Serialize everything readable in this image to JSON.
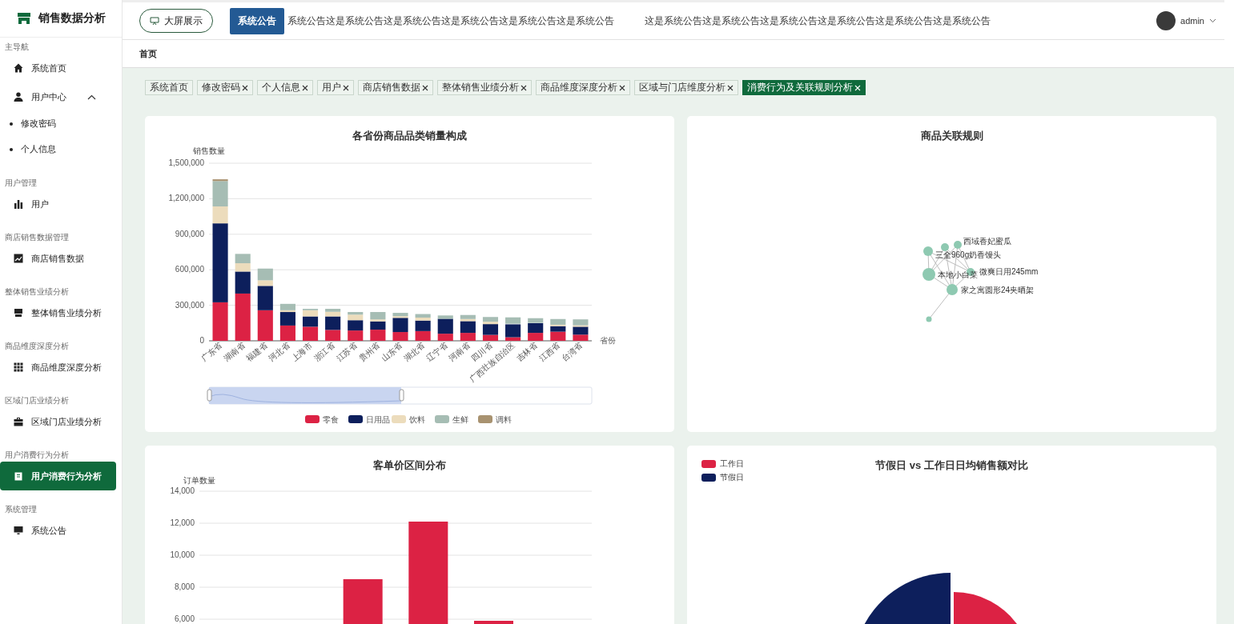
{
  "sidebar": {
    "title": "销售数据分析",
    "sections": [
      {
        "label": "主导航",
        "items": [
          {
            "label": "系统首页",
            "selected": false
          },
          {
            "label": "用户中心",
            "selected": false,
            "expanded": true,
            "children": [
              {
                "label": "修改密码",
                "selected": false
              },
              {
                "label": "个人信息",
                "selected": false
              }
            ]
          }
        ]
      },
      {
        "label": "用户管理",
        "items": [
          {
            "label": "用户",
            "selected": false
          }
        ]
      },
      {
        "label": "商店销售数据管理",
        "items": [
          {
            "label": "商店销售数据",
            "selected": false
          }
        ]
      },
      {
        "label": "整体销售业绩分析",
        "items": [
          {
            "label": "整体销售业绩分析",
            "selected": false
          }
        ]
      },
      {
        "label": "商品维度深度分析",
        "items": [
          {
            "label": "商品维度深度分析",
            "selected": false
          }
        ]
      },
      {
        "label": "区域门店业绩分析",
        "items": [
          {
            "label": "区域门店业绩分析",
            "selected": false
          }
        ]
      },
      {
        "label": "用户消费行为分析",
        "items": [
          {
            "label": "用户消费行为分析",
            "selected": true
          }
        ]
      },
      {
        "label": "系统管理",
        "items": [
          {
            "label": "系统公告",
            "selected": false
          }
        ]
      }
    ]
  },
  "header": {
    "big_screen_button": "大屏展示",
    "notice_label": "系统公告",
    "notices": [
      "系统公告这是系统公告这是系统公告这是系统公告这是系统公告这是系统公告",
      "这是系统公告这是系统公告这是系统公告这是系统公告这是系统公告这是系统公告"
    ],
    "user": "admin"
  },
  "breadcrumb": [
    "首页"
  ],
  "tabs": [
    {
      "label": "系统首页",
      "closable": false,
      "selected": false
    },
    {
      "label": "修改密码",
      "closable": true,
      "selected": false
    },
    {
      "label": "个人信息",
      "closable": true,
      "selected": false
    },
    {
      "label": "用户",
      "closable": true,
      "selected": false
    },
    {
      "label": "商店销售数据",
      "closable": true,
      "selected": false
    },
    {
      "label": "整体销售业绩分析",
      "closable": true,
      "selected": false
    },
    {
      "label": "商品维度深度分析",
      "closable": true,
      "selected": false
    },
    {
      "label": "区域与门店维度分析",
      "closable": true,
      "selected": false
    },
    {
      "label": "消费行为及关联规则分析",
      "closable": true,
      "selected": true
    }
  ],
  "province_chart": {
    "chart_data": {
      "type": "bar",
      "title": "各省份商品品类销量构成",
      "xlabel": "省份",
      "ylabel": "销售数量",
      "stacked": true,
      "grid": true,
      "legend": true,
      "ylim": [
        0,
        1500000
      ],
      "yticks": [
        {
          "value": 0,
          "label": "0"
        },
        {
          "value": 300000,
          "label": "300,000"
        },
        {
          "value": 600000,
          "label": "600,000"
        },
        {
          "value": 900000,
          "label": "900,000"
        },
        {
          "value": 1200000,
          "label": "1,200,000"
        },
        {
          "value": 1500000,
          "label": "1,500,000"
        }
      ],
      "categories": [
        "广东省",
        "湖南省",
        "福建省",
        "河北省",
        "上海市",
        "浙江省",
        "江苏省",
        "贵州省",
        "山东省",
        "湖北省",
        "辽宁省",
        "河南省",
        "四川省",
        "广西壮族自治区",
        "吉林省",
        "江西省",
        "台湾省"
      ],
      "series": [
        {
          "name": "零食",
          "color": "#dc2244",
          "values": [
            325000,
            399000,
            258000,
            129000,
            119000,
            92000,
            87000,
            94000,
            74000,
            82000,
            60000,
            67000,
            50000,
            30000,
            67000,
            77000,
            52000
          ]
        },
        {
          "name": "日用品",
          "color": "#0d1f5c",
          "values": [
            667000,
            186000,
            206000,
            114000,
            87000,
            114000,
            87000,
            70000,
            120000,
            89000,
            126000,
            99000,
            91000,
            109000,
            82000,
            47000,
            67000
          ]
        },
        {
          "name": "饮料",
          "color": "#ecdcbc",
          "values": [
            143000,
            70000,
            47000,
            15000,
            52000,
            39000,
            47000,
            17000,
            14000,
            25000,
            null,
            18000,
            20000,
            5000,
            2000,
            12000,
            12000
          ]
        },
        {
          "name": "生鲜",
          "color": "#a6bdb4",
          "values": [
            214000,
            79000,
            99000,
            54000,
            12000,
            25000,
            22000,
            62000,
            28000,
            30000,
            28000,
            34000,
            40000,
            54000,
            40000,
            48000,
            50000
          ]
        },
        {
          "name": "调料",
          "color": "#a89270",
          "values": [
            15000,
            2000,
            3000,
            2000,
            3000,
            2000,
            2000,
            1000,
            2000,
            2000,
            5000,
            2000,
            1000,
            1000,
            1000,
            1000,
            1000
          ]
        }
      ]
    }
  },
  "association_chart": {
    "title": "商品关联规则",
    "node_labels": [
      "西域香妃蜜瓜",
      "三全960g奶香馒头",
      "本地小白菜",
      "微爽日用245mm",
      "家之寓圆形24夹晒架"
    ]
  },
  "price_chart": {
    "chart_data": {
      "type": "bar",
      "title": "客单价区间分布",
      "ylabel": "订单数量",
      "grid": true,
      "ylim": [
        5550,
        14000
      ],
      "yticks": [
        {
          "value": 6000,
          "label": "6,000"
        },
        {
          "value": 8000,
          "label": "8,000"
        },
        {
          "value": 10000,
          "label": "10,000"
        },
        {
          "value": 12000,
          "label": "12,000"
        },
        {
          "value": 14000,
          "label": "14,000"
        }
      ],
      "values": [
        null,
        null,
        8500,
        12100,
        5900,
        null
      ]
    }
  },
  "holiday_chart": {
    "title": "节假日 vs 工作日日均销售额对比",
    "legend": [
      {
        "label": "工作日",
        "color": "#dc2244"
      },
      {
        "label": "节假日",
        "color": "#0d1f5c"
      }
    ]
  }
}
